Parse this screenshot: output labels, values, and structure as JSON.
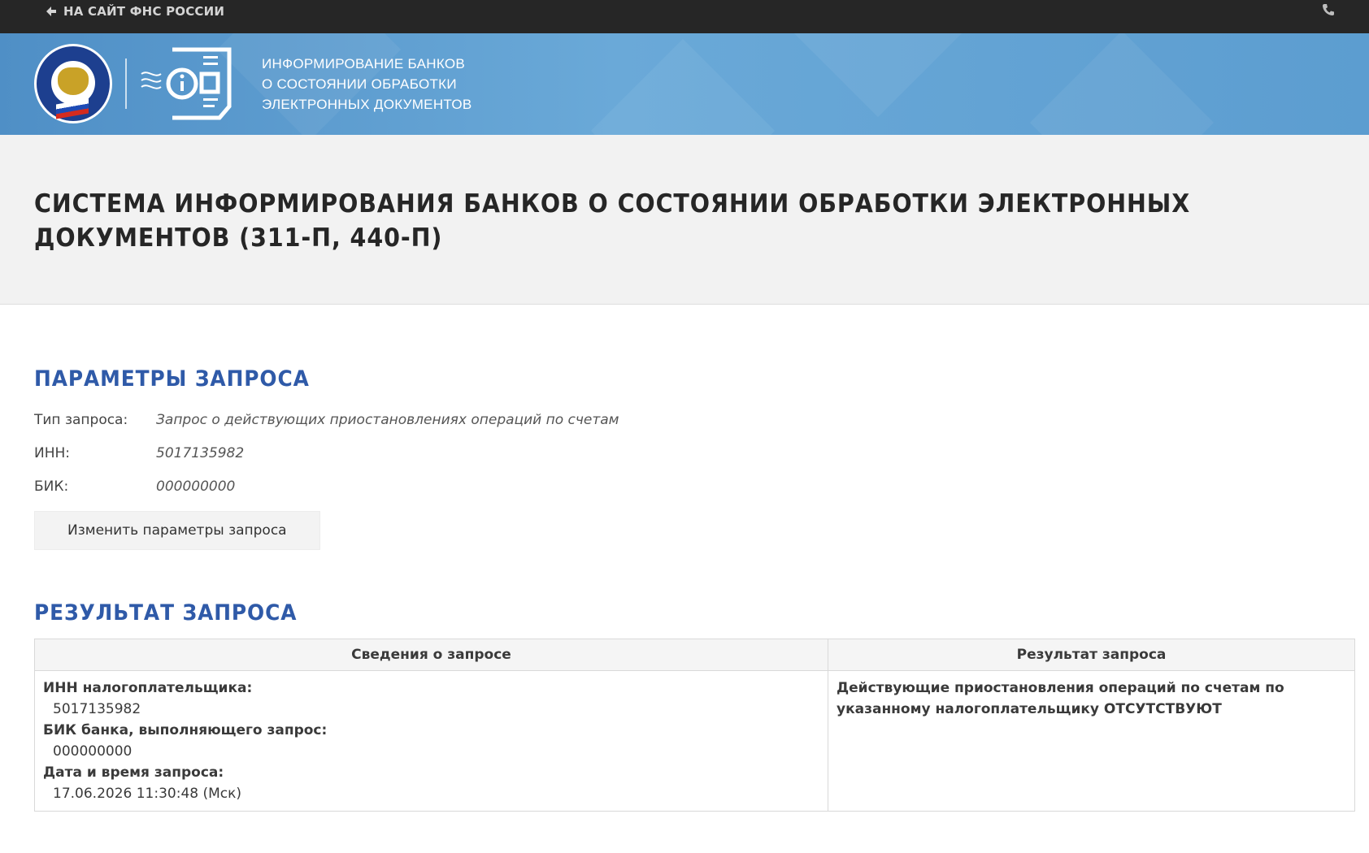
{
  "topbar": {
    "back_link_label": "НА САЙТ ФНС РОССИИ",
    "back_icon": "arrow-left-icon",
    "phone_icon": "phone-icon"
  },
  "banner": {
    "emblem_icon": "fns-emblem-icon",
    "doc_icon": "info-document-icon",
    "title_line1": "ИНФОРМИРОВАНИЕ БАНКОВ",
    "title_line2": "О СОСТОЯНИИ ОБРАБОТКИ",
    "title_line3": "ЭЛЕКТРОННЫХ ДОКУМЕНТОВ"
  },
  "page": {
    "title": "СИСТЕМА ИНФОРМИРОВАНИЯ БАНКОВ О СОСТОЯНИИ ОБРАБОТКИ ЭЛЕКТРОННЫХ ДОКУМЕНТОВ (311-П, 440-П)"
  },
  "params": {
    "heading": "ПАРАМЕТРЫ ЗАПРОСА",
    "rows": [
      {
        "label": "Тип запроса:",
        "value": "Запрос о действующих приостановлениях операций по счетам"
      },
      {
        "label": "ИНН:",
        "value": "5017135982"
      },
      {
        "label": "БИК:",
        "value": "000000000"
      }
    ],
    "change_button": "Изменить параметры запроса"
  },
  "result": {
    "heading": "РЕЗУЛЬТАТ ЗАПРОСА",
    "columns": [
      "Сведения о запросе",
      "Результат запроса"
    ],
    "info": [
      {
        "label": "ИНН налогоплательщика:",
        "value": "5017135982"
      },
      {
        "label": "БИК банка, выполняющего запрос:",
        "value": "000000000"
      },
      {
        "label": "Дата и время запроса:",
        "value": "17.06.2026 11:30:48 (Мск)"
      }
    ],
    "result_text": "Действующие приостановления операций по счетам по указанному налогоплательщику ОТСУТСТВУЮТ"
  },
  "colors": {
    "topbar": "#262626",
    "banner": "#5c9dd0",
    "heading_blue": "#2f5aa8"
  }
}
